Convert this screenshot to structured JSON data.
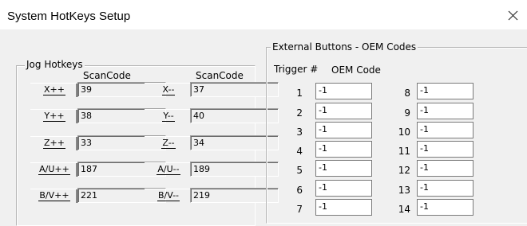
{
  "window": {
    "title": "System HotKeys Setup",
    "close_icon": "close-icon"
  },
  "jog": {
    "group_label": "Jog Hotkeys",
    "scan_header": "ScanCode",
    "rows": [
      {
        "left_label": "X++",
        "left_value": "39",
        "right_label": "X--",
        "right_value": "37"
      },
      {
        "left_label": "Y++",
        "left_value": "38",
        "right_label": "Y--",
        "right_value": "40"
      },
      {
        "left_label": "Z++",
        "left_value": "33",
        "right_label": "Z--",
        "right_value": "34"
      },
      {
        "left_label": "A/U++",
        "left_value": "187",
        "right_label": "A/U--",
        "right_value": "189"
      },
      {
        "left_label": "B/V++",
        "left_value": "221",
        "right_label": "B/V--",
        "right_value": "219"
      }
    ]
  },
  "external": {
    "group_label": "External Buttons - OEM Codes",
    "trigger_header": "Trigger #",
    "oem_header": "OEM Code",
    "left": [
      {
        "n": "1",
        "v": "-1"
      },
      {
        "n": "2",
        "v": "-1"
      },
      {
        "n": "3",
        "v": "-1"
      },
      {
        "n": "4",
        "v": "-1"
      },
      {
        "n": "5",
        "v": "-1"
      },
      {
        "n": "6",
        "v": "-1"
      },
      {
        "n": "7",
        "v": "-1"
      }
    ],
    "right": [
      {
        "n": "8",
        "v": "-1"
      },
      {
        "n": "9",
        "v": "-1"
      },
      {
        "n": "10",
        "v": "-1"
      },
      {
        "n": "11",
        "v": "-1"
      },
      {
        "n": "12",
        "v": "-1"
      },
      {
        "n": "13",
        "v": "-1"
      },
      {
        "n": "14",
        "v": "-1"
      }
    ]
  }
}
